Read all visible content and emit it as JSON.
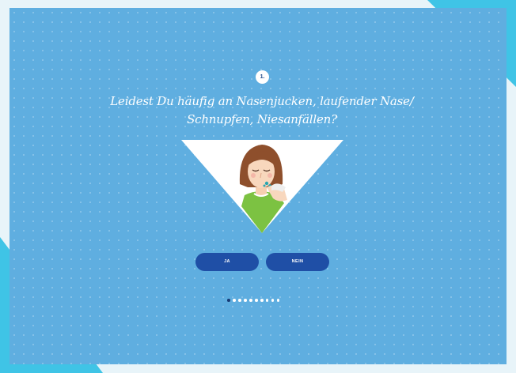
{
  "quiz": {
    "step_number": "1.",
    "question_line1": "Leidest Du häufig an Nasenjucken, laufender Nase/",
    "question_line2": "Schnupfen, Niesanfällen?",
    "yes_label": "JA",
    "no_label": "NEIN",
    "total_steps": 10,
    "current_step": 1
  },
  "colors": {
    "panel": "#5faee0",
    "accent_cyan": "#3fc4e6",
    "button": "#1f4fa6",
    "active_dot": "#173b75"
  }
}
